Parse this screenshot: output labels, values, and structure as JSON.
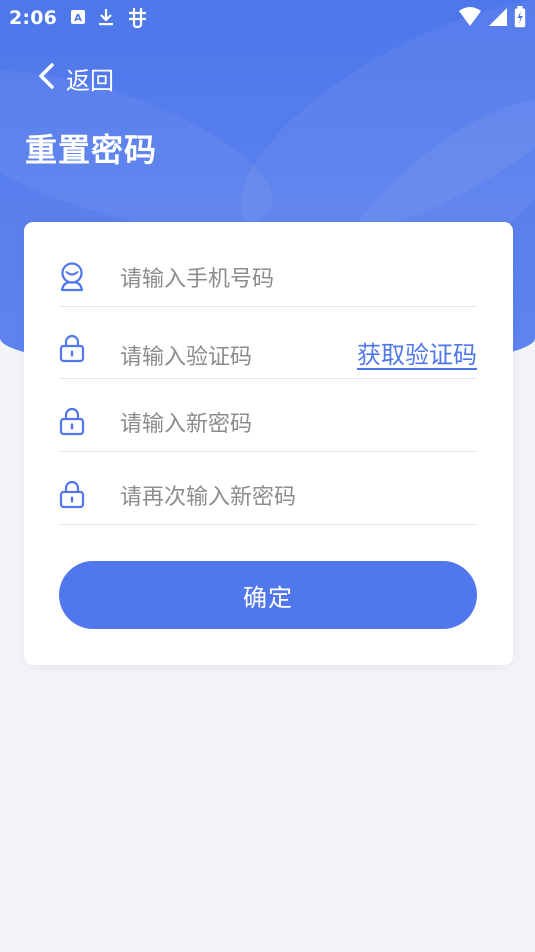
{
  "status_bar": {
    "time": "2:06",
    "left_icons": [
      "a11y-font-icon",
      "download-icon",
      "bug-icon"
    ],
    "right_icons": [
      "wifi-icon",
      "signal-icon",
      "battery-charging-icon"
    ]
  },
  "header": {
    "back_label": "返回",
    "title": "重置密码"
  },
  "form": {
    "phone_placeholder": "请输入手机号码",
    "code_placeholder": "请输入验证码",
    "get_code_label": "获取验证码",
    "new_password_placeholder": "请输入新密码",
    "confirm_password_placeholder": "请再次输入新密码",
    "submit_label": "确定"
  },
  "colors": {
    "primary": "#5177ec",
    "header": "#4d77ea",
    "background": "#f3f4f7",
    "card": "#ffffff",
    "placeholder": "#8c8c8c"
  }
}
